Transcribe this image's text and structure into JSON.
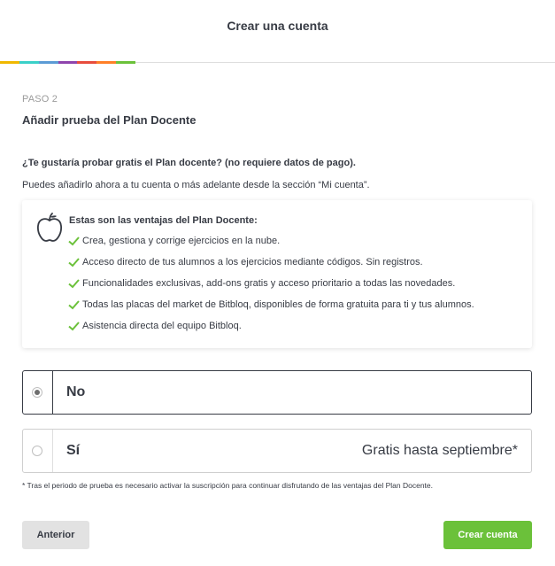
{
  "header": {
    "title": "Crear una cuenta",
    "progress_colors": [
      "#f0b800",
      "#3ad0c8",
      "#5b9bd5",
      "#8e44ad",
      "#e74c3c",
      "#ff7f27",
      "#6bc13a"
    ]
  },
  "step": {
    "label": "PASO 2",
    "title": "Añadir prueba del Plan Docente"
  },
  "question": "¿Te gustaría probar gratis el Plan docente? (no requiere datos de pago).",
  "description": "Puedes añadirlo ahora a tu cuenta o más adelante desde la sección “Mi cuenta”.",
  "benefits": {
    "title": "Estas son las ventajas del Plan Docente:",
    "icon": "apple-icon",
    "items": [
      "Crea, gestiona y corrige ejercicios en la nube.",
      "Acceso directo de tus alumnos a los ejercicios mediante códigos. Sin registros.",
      "Funcionalidades exclusivas, add-ons gratis y acceso prioritario a todas las novedades.",
      "Todas las placas del market de Bitbloq, disponibles de forma gratuita para ti y tus alumnos.",
      "Asistencia directa del equipo Bitbloq."
    ],
    "check_color": "#6bc13a"
  },
  "options": [
    {
      "label": "No",
      "extra": "",
      "selected": true
    },
    {
      "label": "Sí",
      "extra": "Gratis hasta septiembre*",
      "selected": false
    }
  ],
  "footnote": "* Tras el periodo de prueba es necesario activar la suscripción para continuar disfrutando de las ventajas del Plan Docente.",
  "buttons": {
    "back": "Anterior",
    "create": "Crear cuenta"
  },
  "colors": {
    "primary": "#6bc13a",
    "text": "#373b44"
  }
}
